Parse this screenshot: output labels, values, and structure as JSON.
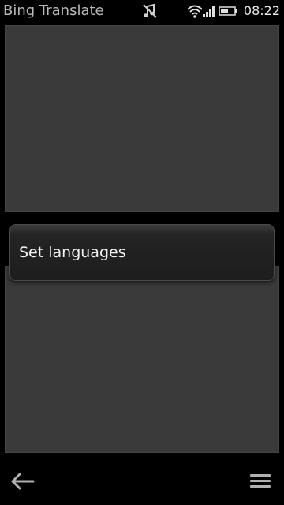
{
  "status_bar": {
    "app_title": "Bing Translate",
    "time": "08:22",
    "icons": [
      "music-muted-icon",
      "wifi-icon",
      "signal-icon",
      "battery-icon"
    ]
  },
  "popup_menu": {
    "items": [
      {
        "label": "Set languages"
      }
    ]
  },
  "toolbar": {
    "left_icon": "back-arrow-icon",
    "right_icon": "options-menu-icon"
  },
  "colors": {
    "background": "#000000",
    "pane": "#3a3a3a",
    "menu": "#1d1d1d",
    "text": "#f2f2f2",
    "status_text": "#b8b8b8"
  }
}
